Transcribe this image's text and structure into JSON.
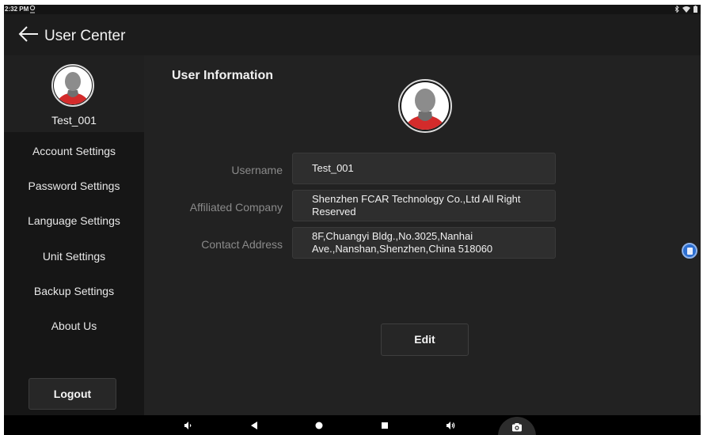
{
  "status_bar": {
    "time": "2:32 PM",
    "icons": [
      "location-icon",
      "bluetooth-icon",
      "wifi-icon",
      "battery-icon"
    ]
  },
  "header": {
    "title": "User Center",
    "back_icon": "arrow-left-icon"
  },
  "sidebar": {
    "profile_name": "Test_001",
    "items": [
      {
        "label": "Account Settings"
      },
      {
        "label": "Password Settings"
      },
      {
        "label": "Language Settings"
      },
      {
        "label": "Unit Settings"
      },
      {
        "label": "Backup Settings"
      },
      {
        "label": "About Us"
      }
    ],
    "logout_label": "Logout"
  },
  "main": {
    "title": "User Information",
    "fields": [
      {
        "label": "Username",
        "value": "Test_001"
      },
      {
        "label": "Affiliated Company",
        "value": "Shenzhen FCAR Technology Co.,Ltd All Right Reserved"
      },
      {
        "label": "Contact Address",
        "value": "8F,Chuangyi Bldg.,No.3025,Nanhai Ave.,Nanshan,Shenzhen,China 518060"
      }
    ],
    "edit_label": "Edit"
  },
  "nav_bar": {
    "icons": [
      "volume-down-icon",
      "back-triangle-icon",
      "home-circle-icon",
      "recents-square-icon",
      "volume-up-icon",
      "camera-icon"
    ]
  },
  "colors": {
    "background": "#222222",
    "sidebar": "#161616",
    "field_bg": "#2e2e2e",
    "avatar_shirt": "#d32b2b",
    "floating_button": "#2d6fd1"
  }
}
